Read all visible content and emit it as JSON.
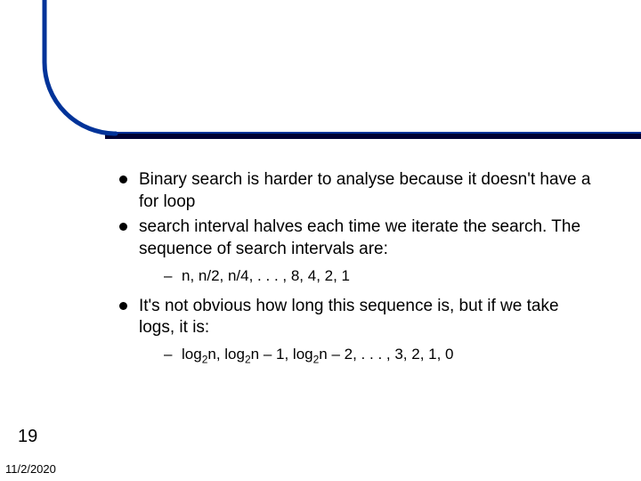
{
  "slide": {
    "bullets": {
      "b1": "Binary search is harder to analyse because it doesn't have a for loop",
      "b2": "search interval halves each time we iterate the search. The sequence of search intervals are:",
      "b2_sub": "n, n/2, n/4, . . . , 8, 4, 2, 1",
      "b3": "It's not obvious how long this sequence is, but if we take logs, it is:",
      "b3_sub_prefix": "log",
      "b3_sub_mid1": "n, log",
      "b3_sub_mid2": "n – 1, log",
      "b3_sub_tail": "n – 2, . . . , 3, 2, 1, 0",
      "sub_two": "2"
    },
    "number": "19",
    "date": "11/2/2020",
    "colors": {
      "accent": "#003399",
      "bar": "#000000"
    }
  }
}
